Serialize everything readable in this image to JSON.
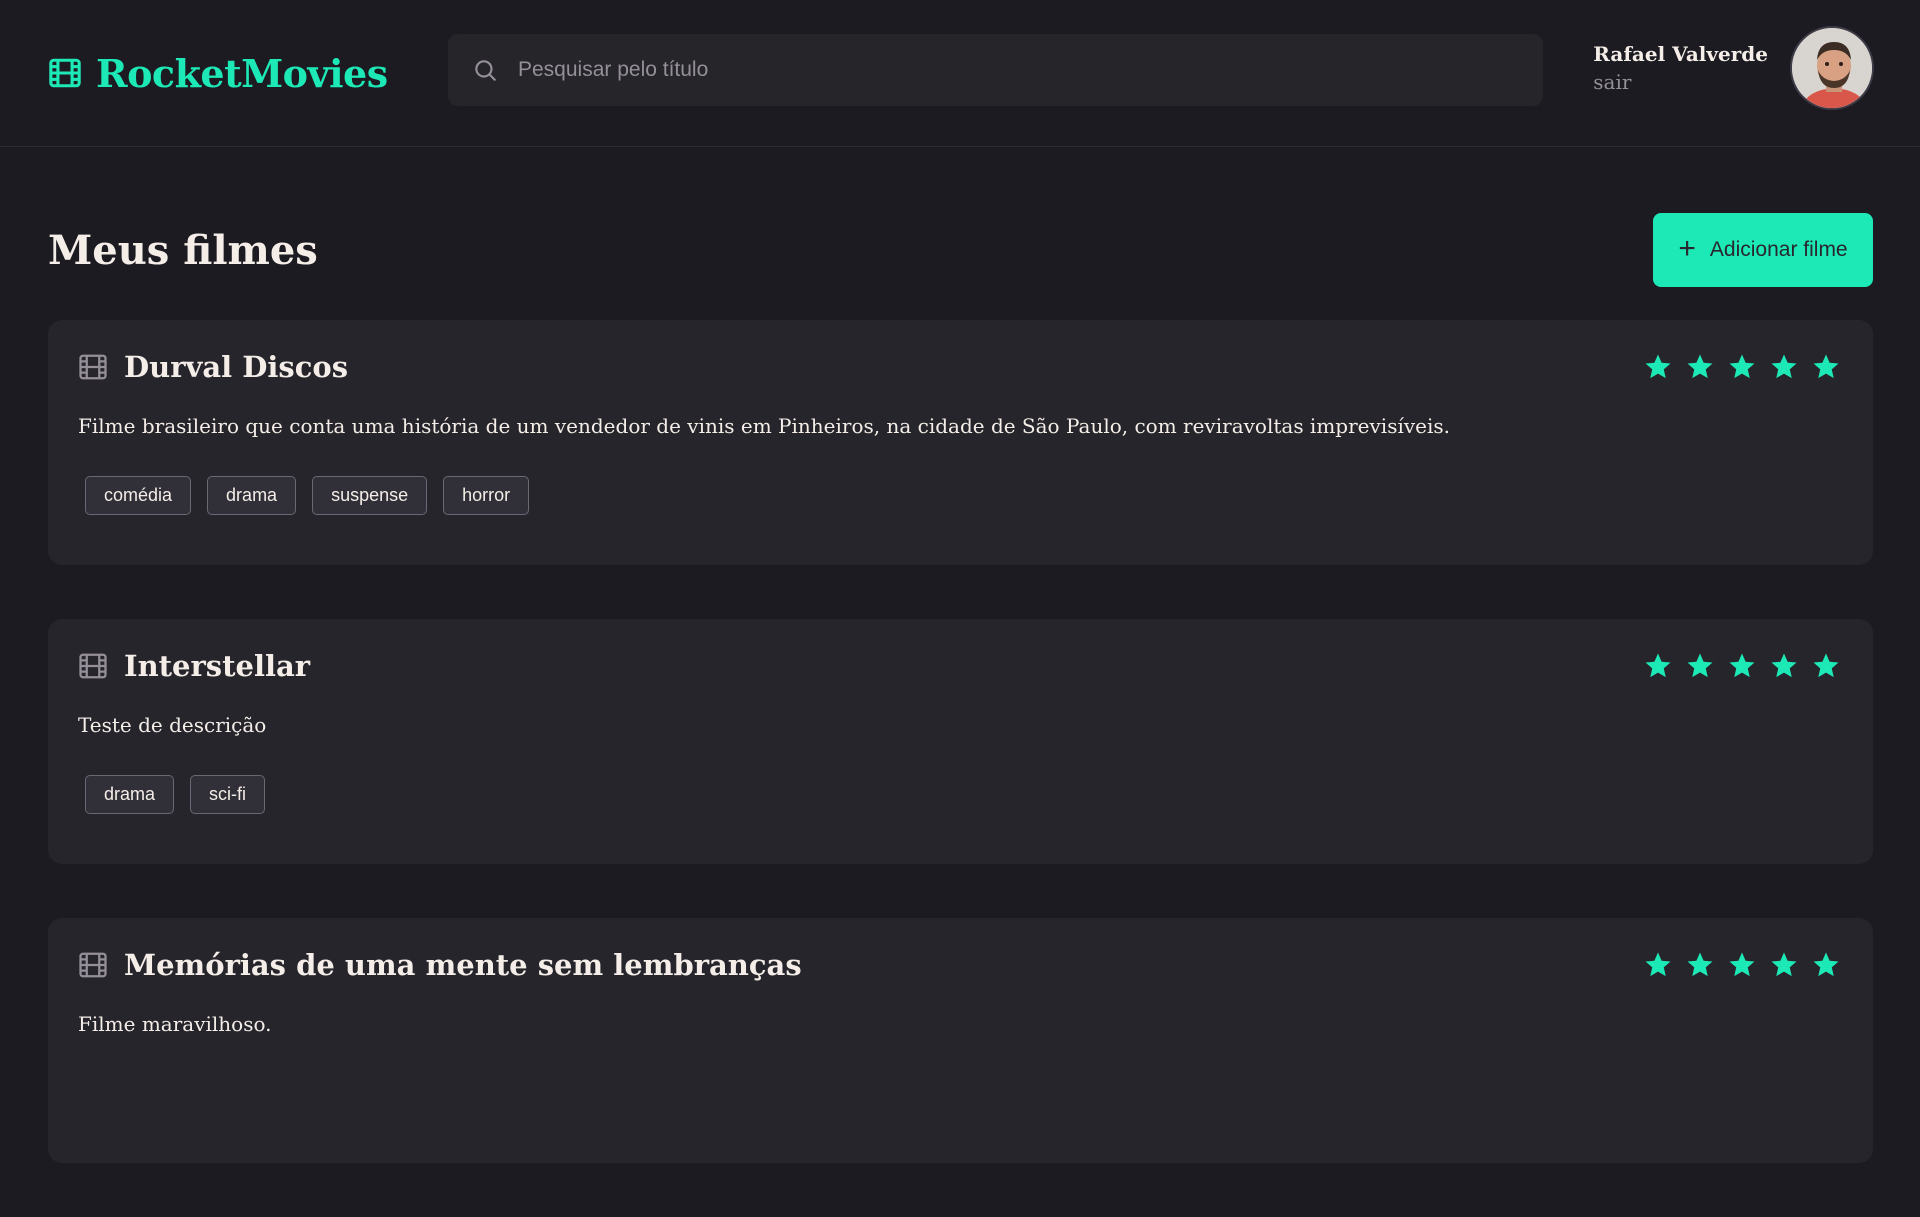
{
  "brand": {
    "name": "RocketMovies"
  },
  "search": {
    "placeholder": "Pesquisar pelo título"
  },
  "profile": {
    "name": "Rafael Valverde",
    "logout": "sair"
  },
  "main": {
    "title": "Meus filmes",
    "add_button": "Adicionar filme"
  },
  "colors": {
    "accent": "#1DE9B6",
    "background": "#1C1B21",
    "card": "#26252B"
  },
  "icons": {
    "brand": "film-icon",
    "search": "search-icon",
    "add": "plus-icon",
    "rating": "star-icon"
  },
  "movies": [
    {
      "title": "Durval Discos",
      "description": "Filme brasileiro que conta uma história de um vendedor de vinis em Pinheiros, na cidade de São Paulo, com reviravoltas imprevisíveis.",
      "rating": 5,
      "tags": [
        "comédia",
        "drama",
        "suspense",
        "horror"
      ]
    },
    {
      "title": "Interstellar",
      "description": "Teste de descrição",
      "rating": 5,
      "tags": [
        "drama",
        "sci-fi"
      ]
    },
    {
      "title": "Memórias de uma mente sem lembranças",
      "description": "Filme maravilhoso.",
      "rating": 5,
      "tags": []
    }
  ]
}
